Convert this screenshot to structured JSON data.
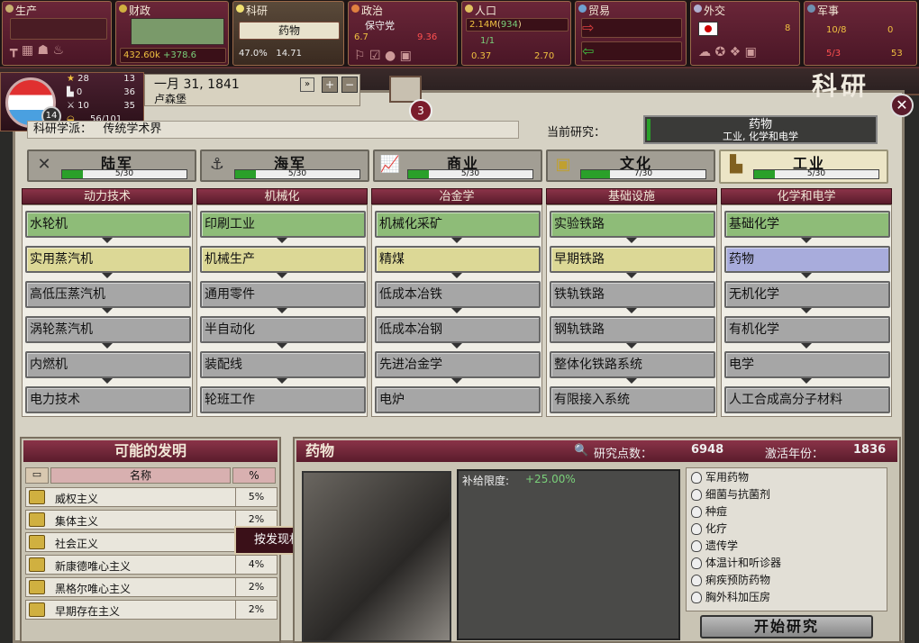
{
  "topbar": {
    "production": {
      "title": "生产"
    },
    "finance": {
      "title": "财政",
      "treasury": "432.60k",
      "income": "+378.6"
    },
    "research": {
      "title": "科研",
      "current": "药物",
      "literacy": "47.0%",
      "points": "14.71"
    },
    "politics": {
      "title": "政治",
      "party": "保守党",
      "plurality": "6.7",
      "revanchism": "9.36",
      "crime": "1/1",
      "militancy": "0.37",
      "consciousness": "2.70"
    },
    "population": {
      "title": "人口",
      "total": "2.14M",
      "growth": "934"
    },
    "trade": {
      "title": "贸易"
    },
    "diplomacy": {
      "title": "外交",
      "diplomats": "8"
    },
    "military": {
      "title": "军事",
      "army": "10/8",
      "army2": "0",
      "navy": "5/3",
      "navy2": "53"
    }
  },
  "country": {
    "rank": "14",
    "prestige": "28",
    "prestige_rank": "13",
    "industry": "0",
    "industry_rank": "36",
    "military": "10",
    "military_rank": "35",
    "supply": "56/101",
    "date": "一月 31, 1841",
    "capital": "卢森堡",
    "alerts": "3"
  },
  "screen": {
    "title": "科研",
    "school_label": "科研学派：",
    "school_value": "传统学术界",
    "current_label": "当前研究：",
    "current_name": "药物",
    "current_folder": "工业, 化学和电学"
  },
  "tabs": [
    {
      "label": "陆军",
      "progress": "5/30",
      "ratio": 0.167
    },
    {
      "label": "海军",
      "progress": "5/30",
      "ratio": 0.167
    },
    {
      "label": "商业",
      "progress": "5/30",
      "ratio": 0.167
    },
    {
      "label": "文化",
      "progress": "7/30",
      "ratio": 0.233
    },
    {
      "label": "工业",
      "progress": "5/30",
      "ratio": 0.167
    }
  ],
  "columns": [
    {
      "head": "动力技术",
      "items": [
        "水轮机",
        "实用蒸汽机",
        "高低压蒸汽机",
        "涡轮蒸汽机",
        "内燃机",
        "电力技术"
      ],
      "states": [
        "g",
        "y",
        "n",
        "n",
        "n",
        "n"
      ]
    },
    {
      "head": "机械化",
      "items": [
        "印刷工业",
        "机械生产",
        "通用零件",
        "半自动化",
        "装配线",
        "轮班工作"
      ],
      "states": [
        "g",
        "y",
        "n",
        "n",
        "n",
        "n"
      ]
    },
    {
      "head": "冶金学",
      "items": [
        "机械化采矿",
        "精煤",
        "低成本冶铁",
        "低成本冶钢",
        "先进冶金学",
        "电炉"
      ],
      "states": [
        "g",
        "y",
        "n",
        "n",
        "n",
        "n"
      ]
    },
    {
      "head": "基础设施",
      "items": [
        "实验铁路",
        "早期铁路",
        "铁轨铁路",
        "钢轨铁路",
        "整体化铁路系统",
        "有限接入系统"
      ],
      "states": [
        "g",
        "y",
        "n",
        "n",
        "n",
        "n"
      ]
    },
    {
      "head": "化学和电学",
      "items": [
        "基础化学",
        "药物",
        "无机化学",
        "有机化学",
        "电学",
        "人工合成高分子材料"
      ],
      "states": [
        "g",
        "b",
        "n",
        "n",
        "n",
        "n"
      ]
    }
  ],
  "inventions": {
    "title": "可能的发明",
    "col_name": "名称",
    "col_pct": "%",
    "rows": [
      {
        "name": "威权主义",
        "pct": "5%"
      },
      {
        "name": "集体主义",
        "pct": "2%"
      },
      {
        "name": "社会正义",
        "pct": "2%"
      },
      {
        "name": "新康德唯心主义",
        "pct": "4%"
      },
      {
        "name": "黑格尔唯心主义",
        "pct": "2%"
      },
      {
        "name": "早期存在主义",
        "pct": "2%"
      }
    ],
    "tooltip": "按发现机会排列可能的发明"
  },
  "tech": {
    "name": "药物",
    "cost_label": "研究点数：",
    "cost": "6948",
    "year_label": "激活年份：",
    "year": "1836",
    "effect_label": "补给限度:",
    "effect_value": "+25.00%",
    "inventions": [
      "军用药物",
      "细菌与抗菌剂",
      "种痘",
      "化疗",
      "遗传学",
      "体温计和听诊器",
      "痢疾预防药物",
      "胸外科加压房"
    ],
    "start_button": "开始研究"
  }
}
